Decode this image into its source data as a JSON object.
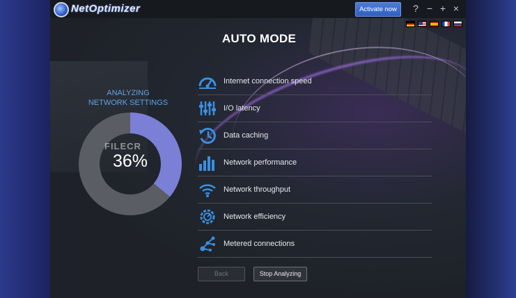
{
  "window": {
    "title": "NetOptimizer",
    "activate_label": "Activate now",
    "help_label": "?",
    "minimize_label": "−",
    "maximize_label": "+",
    "close_label": "×"
  },
  "languages": [
    "de",
    "us",
    "es",
    "fr",
    "ru"
  ],
  "mode_title": "AUTO MODE",
  "status": {
    "line1": "ANALYZING",
    "line2": "NETWORK SETTINGS",
    "progress_text": "36%",
    "progress_fraction": 0.36,
    "accent_color": "#7b7fd6"
  },
  "watermark": "FILECR",
  "items": [
    {
      "label": "Internet connection speed",
      "icon": "speedometer-icon"
    },
    {
      "label": "I/O latency",
      "icon": "equalizer-icon"
    },
    {
      "label": "Data caching",
      "icon": "history-icon"
    },
    {
      "label": "Network performance",
      "icon": "bar-chart-icon"
    },
    {
      "label": "Network throughput",
      "icon": "wifi-icon"
    },
    {
      "label": "Network efficiency",
      "icon": "gear-speed-icon"
    },
    {
      "label": "Metered connections",
      "icon": "network-nodes-icon"
    }
  ],
  "buttons": {
    "back_label": "Back",
    "stop_label": "Stop Analyzing"
  },
  "colors": {
    "icon_blue": "#3b8fe0",
    "activate_blue": "#3a6bcc"
  }
}
